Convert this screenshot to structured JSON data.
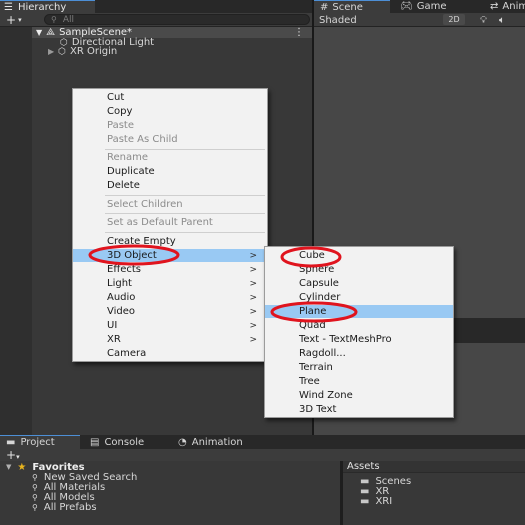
{
  "hierarchy": {
    "tab_title": "Hierarchy",
    "search_placeholder": "All",
    "scene_name": "SampleScene*",
    "items": [
      {
        "label": "Directional Light"
      },
      {
        "label": "XR Origin"
      }
    ]
  },
  "scene": {
    "tabs": [
      {
        "label": "Scene"
      },
      {
        "label": "Game"
      },
      {
        "label": "Anima"
      }
    ],
    "shading": "Shaded",
    "mode_2d": "2D"
  },
  "context_menu": {
    "items": [
      {
        "label": "Cut",
        "enabled": true
      },
      {
        "label": "Copy",
        "enabled": true
      },
      {
        "label": "Paste",
        "enabled": false
      },
      {
        "label": "Paste As Child",
        "enabled": false
      },
      {
        "label": "Rename",
        "enabled": false
      },
      {
        "label": "Duplicate",
        "enabled": true
      },
      {
        "label": "Delete",
        "enabled": true
      },
      {
        "label": "Select Children",
        "enabled": false
      },
      {
        "label": "Set as Default Parent",
        "enabled": false
      },
      {
        "label": "Create Empty",
        "enabled": true
      },
      {
        "label": "3D Object",
        "enabled": true,
        "submenu": true,
        "highlighted": true
      },
      {
        "label": "Effects",
        "enabled": true,
        "submenu": true
      },
      {
        "label": "Light",
        "enabled": true,
        "submenu": true
      },
      {
        "label": "Audio",
        "enabled": true,
        "submenu": true
      },
      {
        "label": "Video",
        "enabled": true,
        "submenu": true
      },
      {
        "label": "UI",
        "enabled": true,
        "submenu": true
      },
      {
        "label": "XR",
        "enabled": true,
        "submenu": true
      },
      {
        "label": "Camera",
        "enabled": true
      }
    ],
    "submenu_arrow": ">"
  },
  "submenu_3d": {
    "items": [
      {
        "label": "Cube"
      },
      {
        "label": "Sphere"
      },
      {
        "label": "Capsule"
      },
      {
        "label": "Cylinder"
      },
      {
        "label": "Plane",
        "highlighted": true
      },
      {
        "label": "Quad"
      },
      {
        "label": "Text - TextMeshPro"
      },
      {
        "label": "Ragdoll..."
      },
      {
        "label": "Terrain"
      },
      {
        "label": "Tree"
      },
      {
        "label": "Wind Zone"
      },
      {
        "label": "3D Text"
      }
    ]
  },
  "bottom": {
    "tabs": [
      {
        "label": "Project"
      },
      {
        "label": "Console"
      },
      {
        "label": "Animation"
      }
    ],
    "favorites": {
      "title": "Favorites",
      "items": [
        {
          "label": "New Saved Search"
        },
        {
          "label": "All Materials"
        },
        {
          "label": "All Models"
        },
        {
          "label": "All Prefabs"
        }
      ]
    },
    "assets": {
      "title": "Assets",
      "folders": [
        {
          "label": "Scenes"
        },
        {
          "label": "XR"
        },
        {
          "label": "XRI"
        }
      ]
    }
  },
  "colors": {
    "menu_highlight": "#99c9f3",
    "annotation_red": "#e0141e",
    "tab_accent": "#4d8fd6"
  }
}
